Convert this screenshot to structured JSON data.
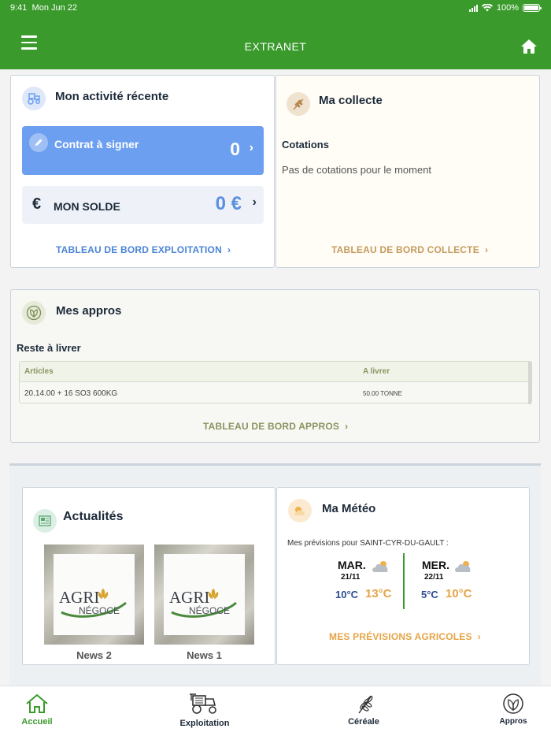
{
  "status_bar": {
    "time": "9:41",
    "date": "Mon Jun 22",
    "battery": "100%"
  },
  "header": {
    "title": "EXTRANET",
    "menu_icon": "hamburger-icon",
    "home_icon": "home-icon"
  },
  "activity": {
    "title": "Mon activité récente",
    "icon": "tractor-icon",
    "contract_label": "Contrat à signer",
    "contract_count": "0",
    "solde_label": "MON SOLDE",
    "solde_symbol": "€",
    "solde_amount": "0 €",
    "link": "TABLEAU DE BORD EXPLOITATION"
  },
  "collecte": {
    "title": "Ma collecte",
    "icon": "wheat-icon",
    "subtitle": "Cotations",
    "empty_text": "Pas de cotations pour le moment",
    "link": "TABLEAU DE BORD COLLECTE"
  },
  "appros": {
    "title": "Mes appros",
    "icon": "leaf-icon",
    "subtitle": "Reste à livrer",
    "columns": [
      "Articles",
      "A livrer"
    ],
    "rows": [
      {
        "article": "20.14.00 + 16 SO3 600KG",
        "a_livrer": "50.00 TONNE"
      }
    ],
    "link": "TABLEAU DE BORD APPROS"
  },
  "news": {
    "title": "Actualités",
    "icon": "newspaper-icon",
    "items": [
      {
        "label": "News 2",
        "logo_text": "AGRI NÉGOCE"
      },
      {
        "label": "News 1",
        "logo_text": "AGRI NÉGOCE"
      }
    ]
  },
  "meteo": {
    "title": "Ma Météo",
    "icon": "sun-cloud-icon",
    "location_text": "Mes prévisions pour SAINT-CYR-DU-GAULT :",
    "days": [
      {
        "day": "MAR.",
        "date": "21/11",
        "min": "10°C",
        "max": "13°C",
        "icon": "cloudy-icon"
      },
      {
        "day": "MER.",
        "date": "22/11",
        "min": "5°C",
        "max": "10°C",
        "icon": "cloudy-icon"
      }
    ],
    "link": "MES PRÉVISIONS AGRICOLES"
  },
  "bottom_nav": [
    {
      "label": "Accueil",
      "icon": "home-outline-icon",
      "active": true
    },
    {
      "label": "Exploitation",
      "icon": "harvester-icon",
      "active": false
    },
    {
      "label": "Céréale",
      "icon": "grain-icon",
      "active": false
    },
    {
      "label": "Appros",
      "icon": "sprout-icon",
      "active": false
    }
  ],
  "colors": {
    "brand_green": "#3a9a2c",
    "blue": "#6c9ff0",
    "gold": "#c49a5e",
    "olive": "#8a9461",
    "orange": "#e6a445"
  }
}
